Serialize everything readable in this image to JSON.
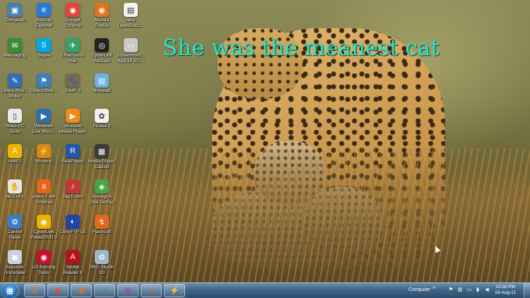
{
  "wallpaper": {
    "caption": "She was the meanest cat"
  },
  "desktop_icons": [
    {
      "label": "Computer",
      "icon": "computer-icon",
      "color": "#4a7fb0",
      "glyph": "▣"
    },
    {
      "label": "Internet\nExplorer",
      "icon": "internet-explorer-icon",
      "color": "#2b79d6",
      "glyph": "e"
    },
    {
      "label": "Google\nChrome",
      "icon": "google-chrome-icon",
      "color": "#e0463a",
      "glyph": "◉"
    },
    {
      "label": "Mozilla\nFirefox",
      "icon": "firefox-icon",
      "color": "#e2731c",
      "glyph": "◉"
    },
    {
      "label": "New\nOpenDocu...",
      "icon": "document-icon",
      "color": "#f2f2f2",
      "glyph": "▤"
    },
    {
      "label": "Messaging",
      "icon": "messaging-icon",
      "color": "#3c8a3c",
      "glyph": "✉"
    },
    {
      "label": "Skype",
      "icon": "skype-icon",
      "color": "#00a8e8",
      "glyph": "S"
    },
    {
      "label": "LinePlanes\nHat",
      "icon": "lineplanes-icon",
      "color": "#3aa06a",
      "glyph": "✈"
    },
    {
      "label": "CyberLink\nYouCam",
      "icon": "youcam-icon",
      "color": "#222222",
      "glyph": "◎"
    },
    {
      "label": "ScreenHunt...\nAug.18 22:...",
      "icon": "screenshot-icon",
      "color": "#c9c9c9",
      "glyph": "▭"
    },
    {
      "label": "OpenOffice...\nWriter",
      "icon": "openoffice-writer-icon",
      "color": "#2f6fb7",
      "glyph": "✎"
    },
    {
      "label": "OpenOffice...",
      "icon": "openoffice-icon",
      "color": "#3d7fc4",
      "glyph": "⚑"
    },
    {
      "label": "GIMP 2",
      "icon": "gimp-icon",
      "color": "#7a6a50",
      "glyph": "🐾"
    },
    {
      "label": "Notepad",
      "icon": "notepad-icon",
      "color": "#6fb0e6",
      "glyph": "▤"
    },
    {
      "label": "Nokia PC\nSuite",
      "icon": "nokia-pc-suite-icon",
      "color": "#e9e9e9",
      "glyph": "▯"
    },
    {
      "label": "Windows\nLive Movi...",
      "icon": "live-movie-maker-icon",
      "color": "#2e6fb0",
      "glyph": "▶"
    },
    {
      "label": "Windows\nMedia Player",
      "icon": "media-player-icon",
      "color": "#f08a1c",
      "glyph": "▶"
    },
    {
      "label": "Picasa 3",
      "icon": "picasa-icon",
      "color": "#f2f2f2",
      "glyph": "✿"
    },
    {
      "label": "AIMP2",
      "icon": "aimp-icon",
      "color": "#f0b400",
      "glyph": "A"
    },
    {
      "label": "Winamp",
      "icon": "winamp-icon",
      "color": "#d68a1e",
      "glyph": "⚡"
    },
    {
      "label": "RealPlayer",
      "icon": "realplayer-icon",
      "color": "#2256a8",
      "glyph": "R"
    },
    {
      "label": "Media Player\nClassic",
      "icon": "mpc-icon",
      "color": "#3a3a3a",
      "glyph": "▦"
    },
    {
      "label": "No Entry",
      "icon": "no-entry-icon",
      "color": "#e6e6e6",
      "glyph": "✋"
    },
    {
      "label": "avast! Free\nAntivirus",
      "icon": "avast-icon",
      "color": "#e8641c",
      "glyph": "a"
    },
    {
      "label": "Tag Editor",
      "icon": "tag-editor-icon",
      "color": "#c23838",
      "glyph": "♪"
    },
    {
      "label": "Auslogics\nDisk Defrag",
      "icon": "disk-defrag-icon",
      "color": "#4aa34a",
      "glyph": "◈"
    },
    {
      "label": "Control\nPanel",
      "icon": "control-panel-icon",
      "color": "#3a7ec4",
      "glyph": "⚙"
    },
    {
      "label": "CyberLink\nPowerDVD 9",
      "icon": "powerdvd-icon",
      "color": "#e8b400",
      "glyph": "◉"
    },
    {
      "label": "Core FTP LE",
      "icon": "core-ftp-icon",
      "color": "#2244aa",
      "glyph": "◐"
    },
    {
      "label": "FlashGet",
      "icon": "flashget-icon",
      "color": "#e06a1c",
      "glyph": "↯"
    },
    {
      "label": "Absolute\nUninstaller",
      "icon": "uninstaller-icon",
      "color": "#c7cfe0",
      "glyph": "▣"
    },
    {
      "label": "LG Burning\nTools",
      "icon": "lg-burning-icon",
      "color": "#c8102e",
      "glyph": "◉"
    },
    {
      "label": "Adobe\nReader 9",
      "icon": "adobe-reader-icon",
      "color": "#b5121b",
      "glyph": "A"
    },
    {
      "label": "DNG Skydin\n3D",
      "icon": "recycle-bin-icon",
      "color": "#9fb7cc",
      "glyph": "♻"
    }
  ],
  "taskbar": {
    "start_icon": "windows-start-icon",
    "pinned": [
      {
        "icon": "aimp-taskbar-icon",
        "color": "#f07a1c",
        "glyph": "☰"
      },
      {
        "icon": "chrome-taskbar-icon",
        "color": "#e0463a",
        "glyph": "◉"
      },
      {
        "icon": "firefox-taskbar-icon",
        "color": "#e2731c",
        "glyph": "◉"
      },
      {
        "icon": "internet-explorer-taskbar-icon",
        "color": "#2b9c4a",
        "glyph": "e"
      },
      {
        "icon": "winrar-taskbar-icon",
        "color": "#8a4fb0",
        "glyph": "▦"
      },
      {
        "icon": "music-taskbar-icon",
        "color": "#e0621c",
        "glyph": "♫"
      },
      {
        "icon": "winamp-taskbar-icon",
        "color": "#d68a1e",
        "glyph": "⚡"
      }
    ],
    "toolbar_label": "Computer",
    "clock": {
      "time": "10:06 PM",
      "date": "18-Aug-11"
    }
  }
}
